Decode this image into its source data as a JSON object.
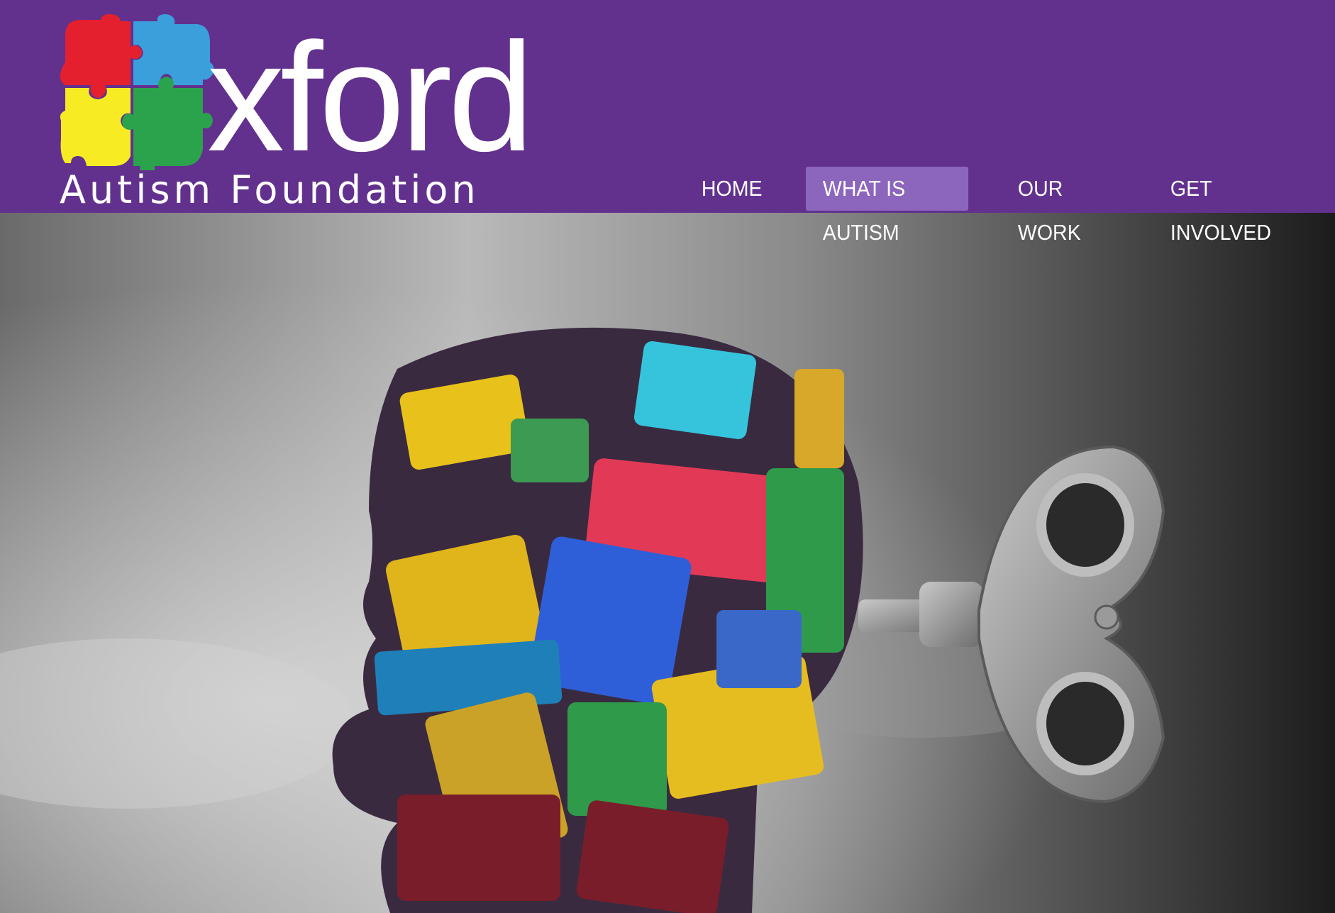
{
  "logo": {
    "word": "xford",
    "subtitle": "Autism Foundation",
    "piece_colors": [
      "#e5202e",
      "#3b9fdc",
      "#f7ec24",
      "#2ba24c"
    ]
  },
  "nav": {
    "items": [
      {
        "label": "HOME",
        "active": false
      },
      {
        "label": "WHAT IS AUTISM",
        "active": true
      },
      {
        "label": "OUR WORK",
        "active": false
      },
      {
        "label": "GET INVOLVED",
        "active": false
      }
    ]
  },
  "colors": {
    "header_bg": "#62318e",
    "nav_active_bg": "#8c66bd",
    "text": "#ffffff"
  },
  "hero": {
    "image": "puzzle-head-wind-up-key",
    "puzzle_colors": [
      "#e8c21a",
      "#36c4dc",
      "#e23a56",
      "#2f5fd8",
      "#2f9a4a",
      "#7a1d2a",
      "#1f7fb8",
      "#c9a227"
    ]
  }
}
